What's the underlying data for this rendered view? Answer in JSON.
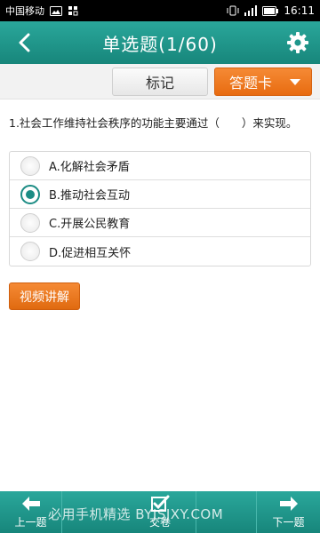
{
  "status_bar": {
    "carrier": "中国移动",
    "time": "16:11"
  },
  "header": {
    "title": "单选题(1/60)"
  },
  "toolbar": {
    "mark_label": "标记",
    "answer_card_label": "答题卡"
  },
  "question": {
    "text": "1.社会工作维持社会秩序的功能主要通过（　　）来实现。",
    "options": [
      {
        "label": "A.化解社会矛盾",
        "selected": false
      },
      {
        "label": "B.推动社会互动",
        "selected": true
      },
      {
        "label": "C.开展公民教育",
        "selected": false
      },
      {
        "label": "D.促进相互关怀",
        "selected": false
      }
    ]
  },
  "video_button": "视频讲解",
  "bottom_bar": {
    "prev_label": "上一题",
    "submit_label": "交卷",
    "next_label": "下一题"
  },
  "watermark": "必用手机精选 BYJSJXY.COM",
  "colors": {
    "teal": "#1f978c",
    "orange": "#ea7218",
    "selected_radio": "#1b8c84"
  }
}
